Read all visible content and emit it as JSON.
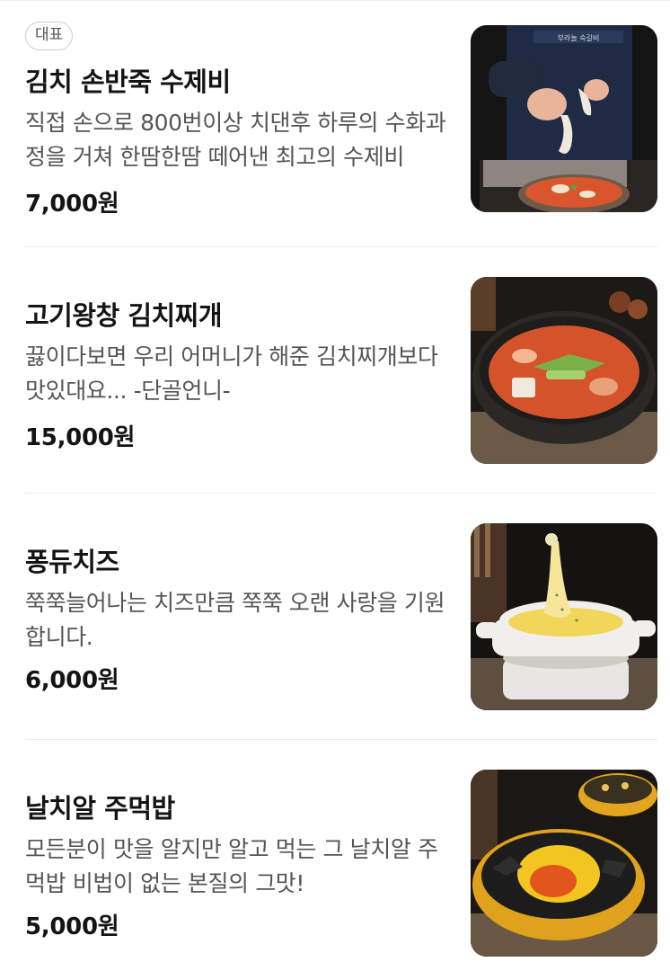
{
  "menu": {
    "items": [
      {
        "badge": "대표",
        "name": "김치 손반죽 수제비",
        "description": "직접 손으로 800번이상 치댄후 하루의 수화과정을 거쳐 한땀한땀 떼어낸 최고의 수제비",
        "price": "7,000원",
        "image_icon": "sujebi-photo"
      },
      {
        "name": "고기왕창 김치찌개",
        "description": "끓이다보면 우리 어머니가 해준 김치찌개보다 맛있대요... -단골언니-",
        "price": "15,000원",
        "image_icon": "kimchi-stew-photo"
      },
      {
        "name": "퐁듀치즈",
        "description": "쭉쭉늘어나는 치즈만큼 쭉쭉 오랜 사랑을 기원합니다.",
        "price": "6,000원",
        "image_icon": "cheese-fondue-photo"
      },
      {
        "name": "날치알 주먹밥",
        "description": "모든분이 맛을 알지만 알고 먹는 그 날치알 주먹밥 비법이 없는 본질의 그맛!",
        "price": "5,000원",
        "image_icon": "flying-fish-roe-rice-photo"
      }
    ]
  },
  "colors": {
    "price": "#141414",
    "description": "#555555",
    "divider": "#ececec",
    "badge_border": "#cfcfcf"
  }
}
